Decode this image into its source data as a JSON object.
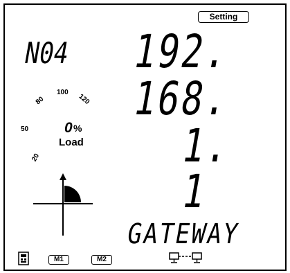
{
  "status_bar": {
    "setting_label": "Setting"
  },
  "device": {
    "number": "N04"
  },
  "address": {
    "octets": [
      "192.",
      "168.",
      "1.",
      "1"
    ]
  },
  "parameter": {
    "label": "GATEWAY"
  },
  "load_gauge": {
    "ticks": [
      "20",
      "50",
      "80",
      "100",
      "120"
    ],
    "value": "0",
    "unit": "%",
    "label": "Load"
  },
  "quadrant": {
    "active": "I"
  },
  "bottom_icons": {
    "m1_label": "M1",
    "m2_label": "M2",
    "meter_icon": "meter-icon",
    "network_icon": "network-icon"
  }
}
